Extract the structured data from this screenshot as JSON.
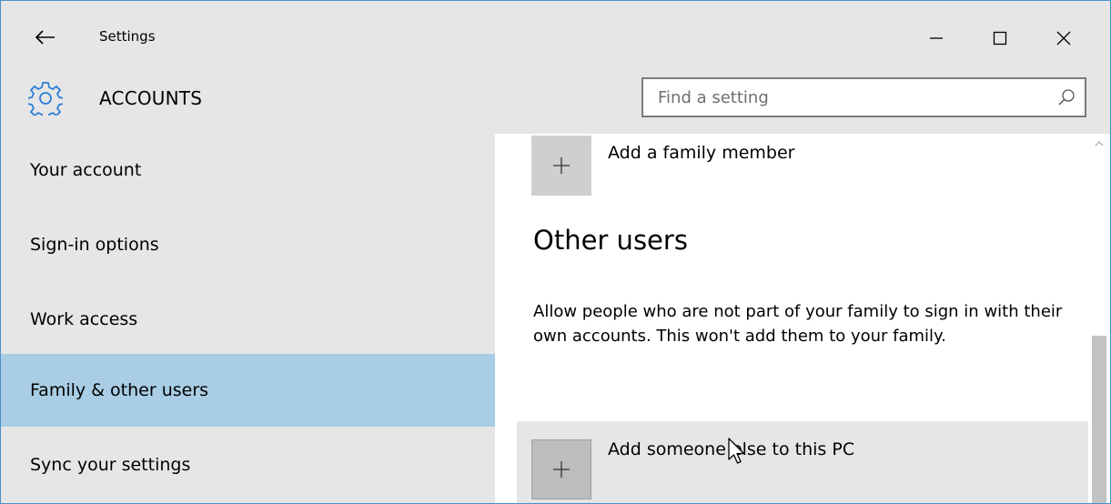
{
  "window": {
    "title": "Settings"
  },
  "header": {
    "section": "ACCOUNTS",
    "search_placeholder": "Find a setting"
  },
  "sidebar": {
    "items": [
      {
        "label": "Your account"
      },
      {
        "label": "Sign-in options"
      },
      {
        "label": "Work access"
      },
      {
        "label": "Family & other users"
      },
      {
        "label": "Sync your settings"
      }
    ],
    "selected": "Family & other users"
  },
  "content": {
    "add_family_label": "Add a family member",
    "other_users_title": "Other users",
    "other_users_desc": "Allow people who are not part of your family to sign in with their own accounts. This won't add them to your family.",
    "add_someone_label": "Add someone else to this PC"
  },
  "colors": {
    "chrome": "#e6e6e6",
    "selected": "#a8cde4",
    "accent": "#2a7fd4",
    "tile": "#cfcfcf"
  },
  "icons": {
    "back": "back-arrow-icon",
    "gear": "gear-icon",
    "search": "search-icon",
    "plus": "plus-icon"
  }
}
